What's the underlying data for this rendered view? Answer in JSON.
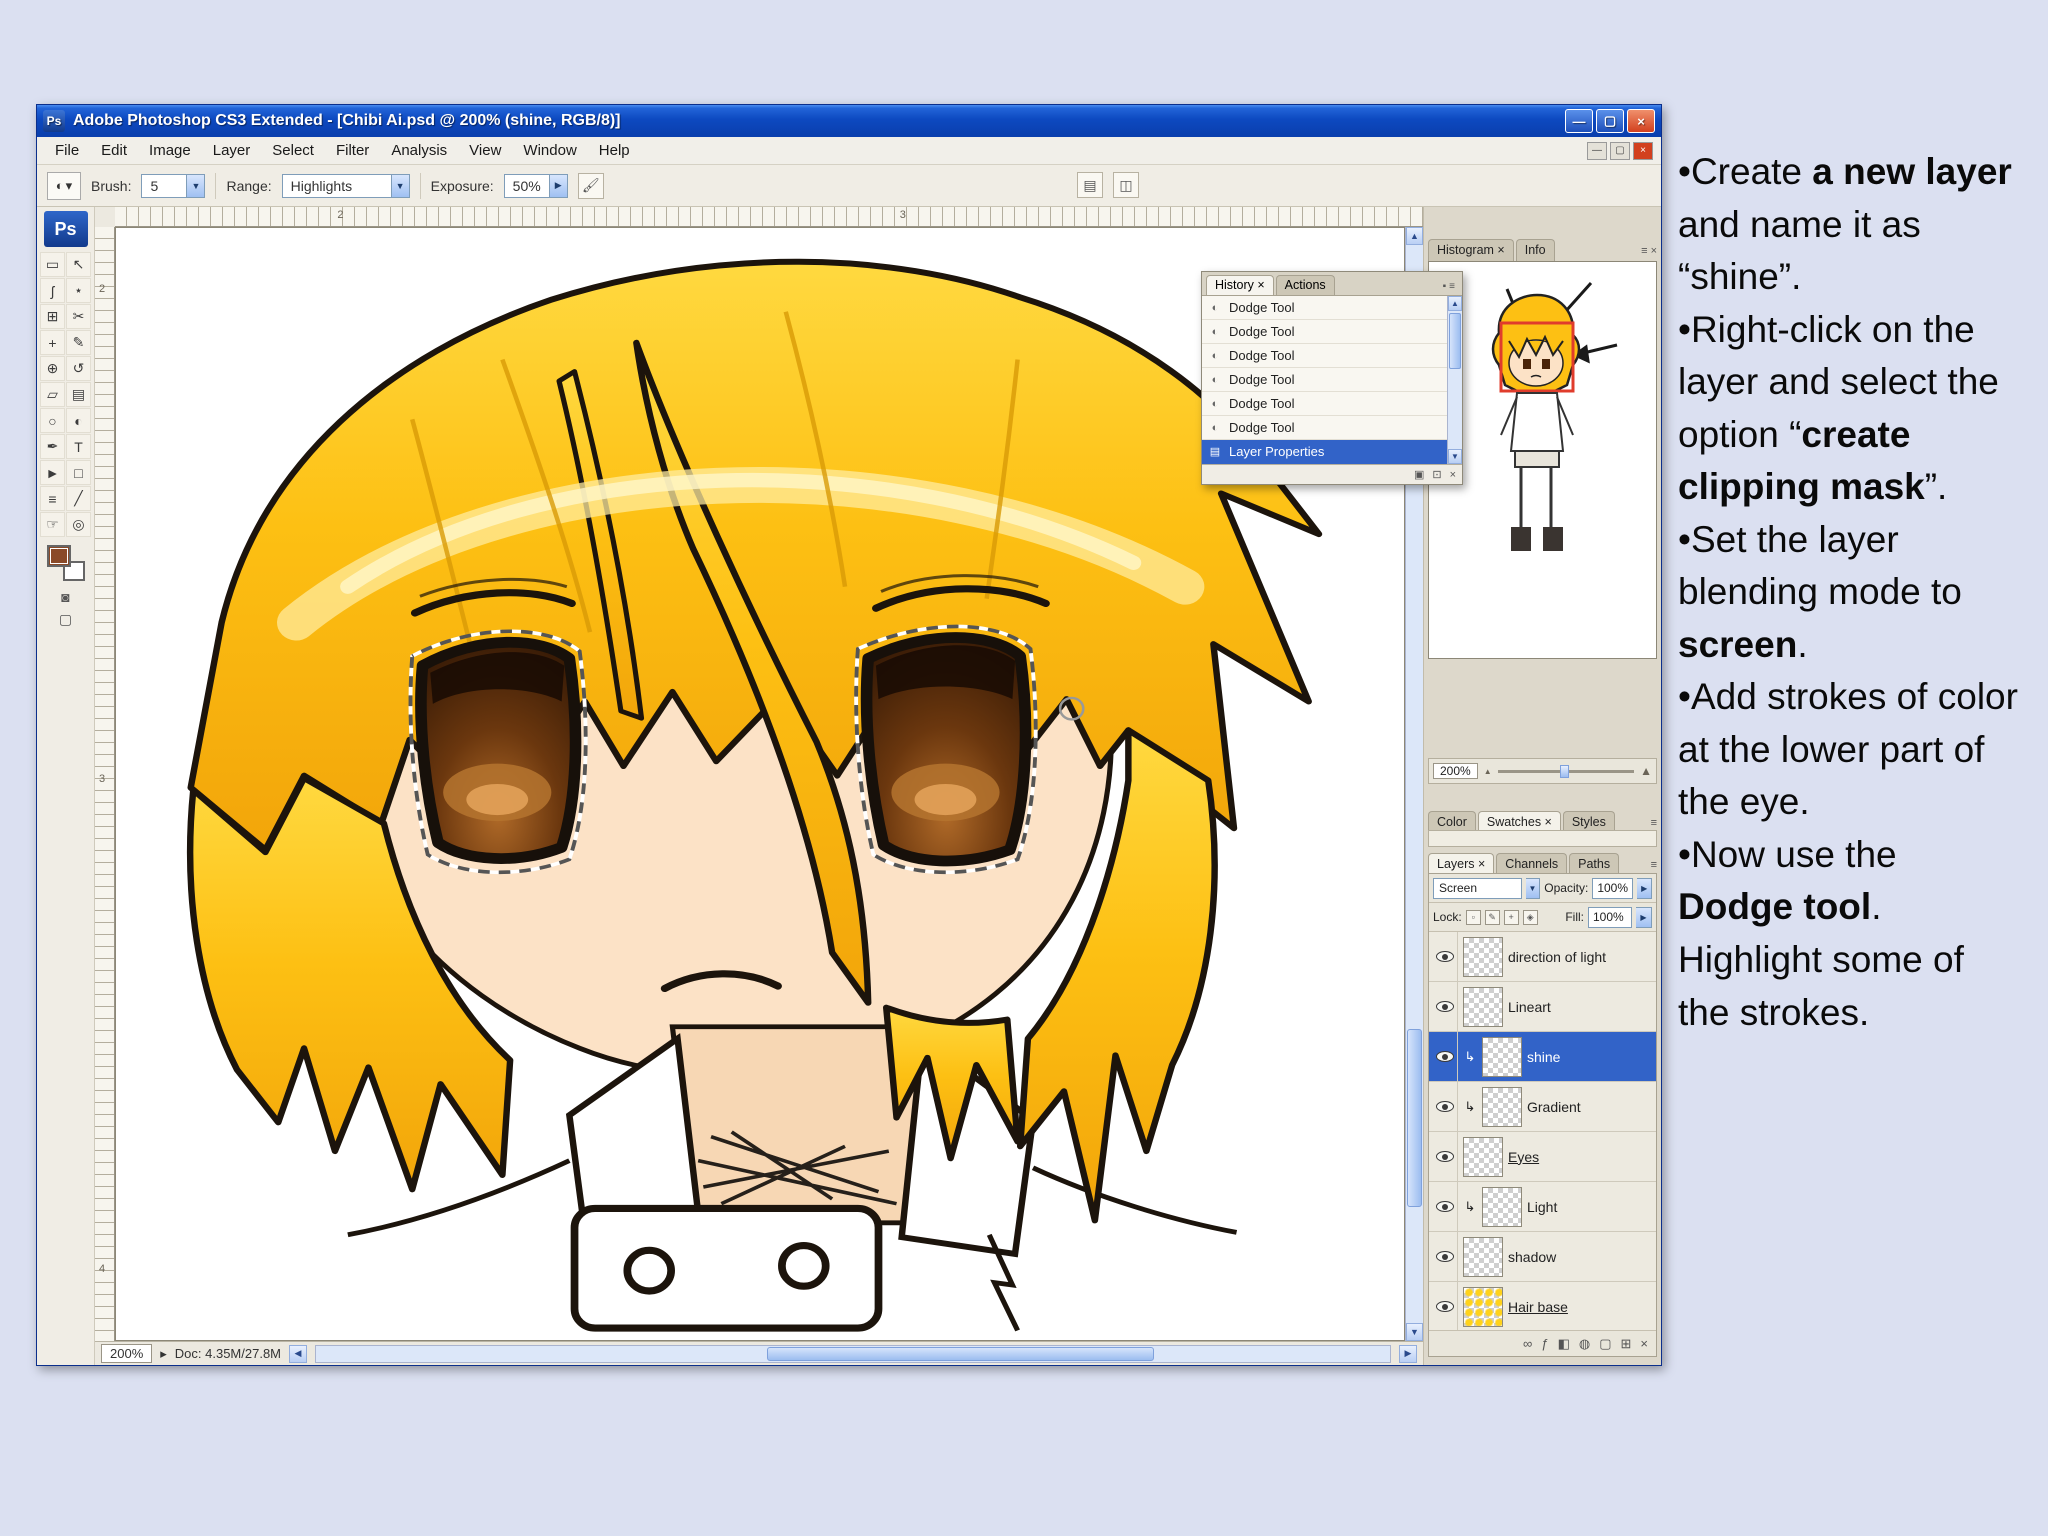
{
  "app": {
    "title": "Adobe Photoshop CS3 Extended - [Chibi Ai.psd @ 200% (shine, RGB/8)]",
    "logo": "Ps",
    "menus": [
      "File",
      "Edit",
      "Image",
      "Layer",
      "Select",
      "Filter",
      "Analysis",
      "View",
      "Window",
      "Help"
    ],
    "options_bar": {
      "brush_label": "Brush:",
      "brush_size": "5",
      "range_label": "Range:",
      "range_value": "Highlights",
      "exposure_label": "Exposure:",
      "exposure_value": "50%"
    },
    "rulers": {
      "top": [
        "2",
        "3"
      ],
      "left": [
        "2",
        "3",
        "4"
      ]
    },
    "status": {
      "zoom": "200%",
      "doc_info": "Doc: 4.35M/27.8M"
    }
  },
  "history_panel": {
    "tab_history": "History ×",
    "tab_actions": "Actions",
    "entries": [
      "Dodge Tool",
      "Dodge Tool",
      "Dodge Tool",
      "Dodge Tool",
      "Dodge Tool",
      "Dodge Tool"
    ],
    "selected_entry": "Layer Properties"
  },
  "dock": {
    "top_tabs": {
      "histogram": "Histogram ×",
      "info": "Info"
    },
    "navigator_zoom": "200%",
    "color_tabs": {
      "color": "Color",
      "swatches": "Swatches ×",
      "styles": "Styles"
    },
    "layers_tabs": {
      "layers": "Layers ×",
      "channels": "Channels",
      "paths": "Paths"
    },
    "blend_mode": "Screen",
    "opacity_label": "Opacity:",
    "opacity_value": "100%",
    "lock_label": "Lock:",
    "fill_label": "Fill:",
    "fill_value": "100%",
    "layers": [
      {
        "name": "direction of light"
      },
      {
        "name": "Lineart"
      },
      {
        "name": "shine"
      },
      {
        "name": "Gradient"
      },
      {
        "name": "Eyes"
      },
      {
        "name": "Light"
      },
      {
        "name": "shadow"
      },
      {
        "name": "Hair base"
      }
    ]
  },
  "tutorial": {
    "p1": [
      "•Create ",
      "a new layer",
      " and name it as “shine”."
    ],
    "p2": [
      "•Right-click on the layer and select the option “",
      "create clipping mask",
      "”."
    ],
    "p3": [
      "•Set the layer blending mode to ",
      "screen",
      "."
    ],
    "p4": [
      "•Add strokes of color at the lower part of the eye."
    ],
    "p5": [
      "•Now use the ",
      "Dodge tool",
      ". Highlight some of the strokes."
    ]
  }
}
